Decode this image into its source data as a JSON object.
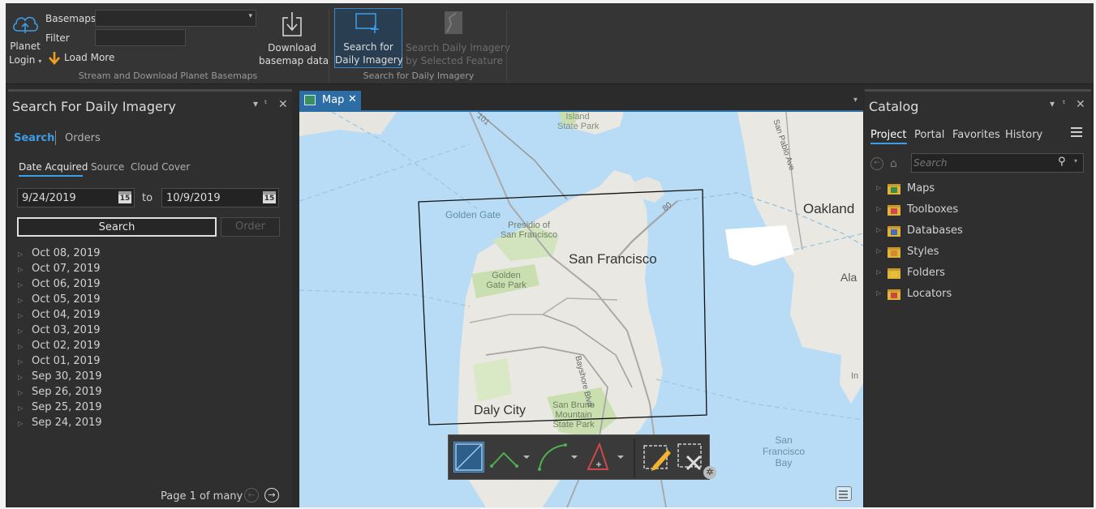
{
  "ribbon": {
    "planet_login_line1": "Planet",
    "planet_login_line2": "Login",
    "basemaps_label": "Basemaps",
    "basemaps_value": "",
    "filter_label": "Filter",
    "filter_value": "",
    "load_more_label": "Load More",
    "download_line1": "Download",
    "download_line2": "basemap data",
    "group1_label": "Stream and Download Planet Basemaps",
    "search_daily_line1": "Search for",
    "search_daily_line2": "Daily Imagery",
    "search_selected_line1": "Search Daily Imagery",
    "search_selected_line2": "by Selected Feature",
    "group2_label": "Search for Daily Imagery"
  },
  "left_panel": {
    "title": "Search For Daily Imagery",
    "tabs": [
      "Search",
      "Orders"
    ],
    "subtabs": [
      "Date Acquired",
      "Source",
      "Cloud Cover"
    ],
    "date_from": "9/24/2019",
    "date_to": "10/9/2019",
    "to_label": "to",
    "calendar_day": "15",
    "search_button": "Search",
    "order_button": "Order",
    "dates": [
      "Oct 08, 2019",
      "Oct 07, 2019",
      "Oct 06, 2019",
      "Oct 05, 2019",
      "Oct 04, 2019",
      "Oct 03, 2019",
      "Oct 02, 2019",
      "Oct 01, 2019",
      "Sep 30, 2019",
      "Sep 26, 2019",
      "Sep 25, 2019",
      "Sep 24, 2019"
    ],
    "page_text": "Page 1 of many"
  },
  "map": {
    "tab_label": "Map",
    "labels": {
      "island_state_park_1": "Island",
      "island_state_park_2": "State Park",
      "golden_gate": "Golden Gate",
      "presidio_1": "Presidio of",
      "presidio_2": "San Francisco",
      "san_francisco": "San Francisco",
      "golden_gate_park_1": "Golden",
      "golden_gate_park_2": "Gate Park",
      "oakland": "Oakland",
      "alameda": "Ala",
      "daly_city": "Daly City",
      "san_bruno_1": "San Bruno",
      "san_bruno_2": "Mountain",
      "san_bruno_3": "State Park",
      "sf_bay_1": "San",
      "sf_bay_2": "Francisco",
      "sf_bay_3": "Bay",
      "bayshore": "Bayshore Blvd",
      "san_pablo": "San Pablo Ave",
      "hwy_80": "80",
      "hwy_101": "101",
      "hwy_35": "35",
      "in_label": "In"
    }
  },
  "catalog": {
    "title": "Catalog",
    "tabs": [
      "Project",
      "Portal",
      "Favorites",
      "History"
    ],
    "search_placeholder": "Search",
    "items": [
      {
        "label": "Maps",
        "icon": "maps-folder-icon"
      },
      {
        "label": "Toolboxes",
        "icon": "toolboxes-folder-icon"
      },
      {
        "label": "Databases",
        "icon": "databases-folder-icon"
      },
      {
        "label": "Styles",
        "icon": "styles-folder-icon"
      },
      {
        "label": "Folders",
        "icon": "folders-folder-icon"
      },
      {
        "label": "Locators",
        "icon": "locators-folder-icon"
      }
    ]
  },
  "colors": {
    "accent": "#3c9ee8",
    "map_tab": "#2d6da6",
    "water": "#b8dcf5",
    "land": "#e9e8e3",
    "park": "#c9dfb0"
  }
}
